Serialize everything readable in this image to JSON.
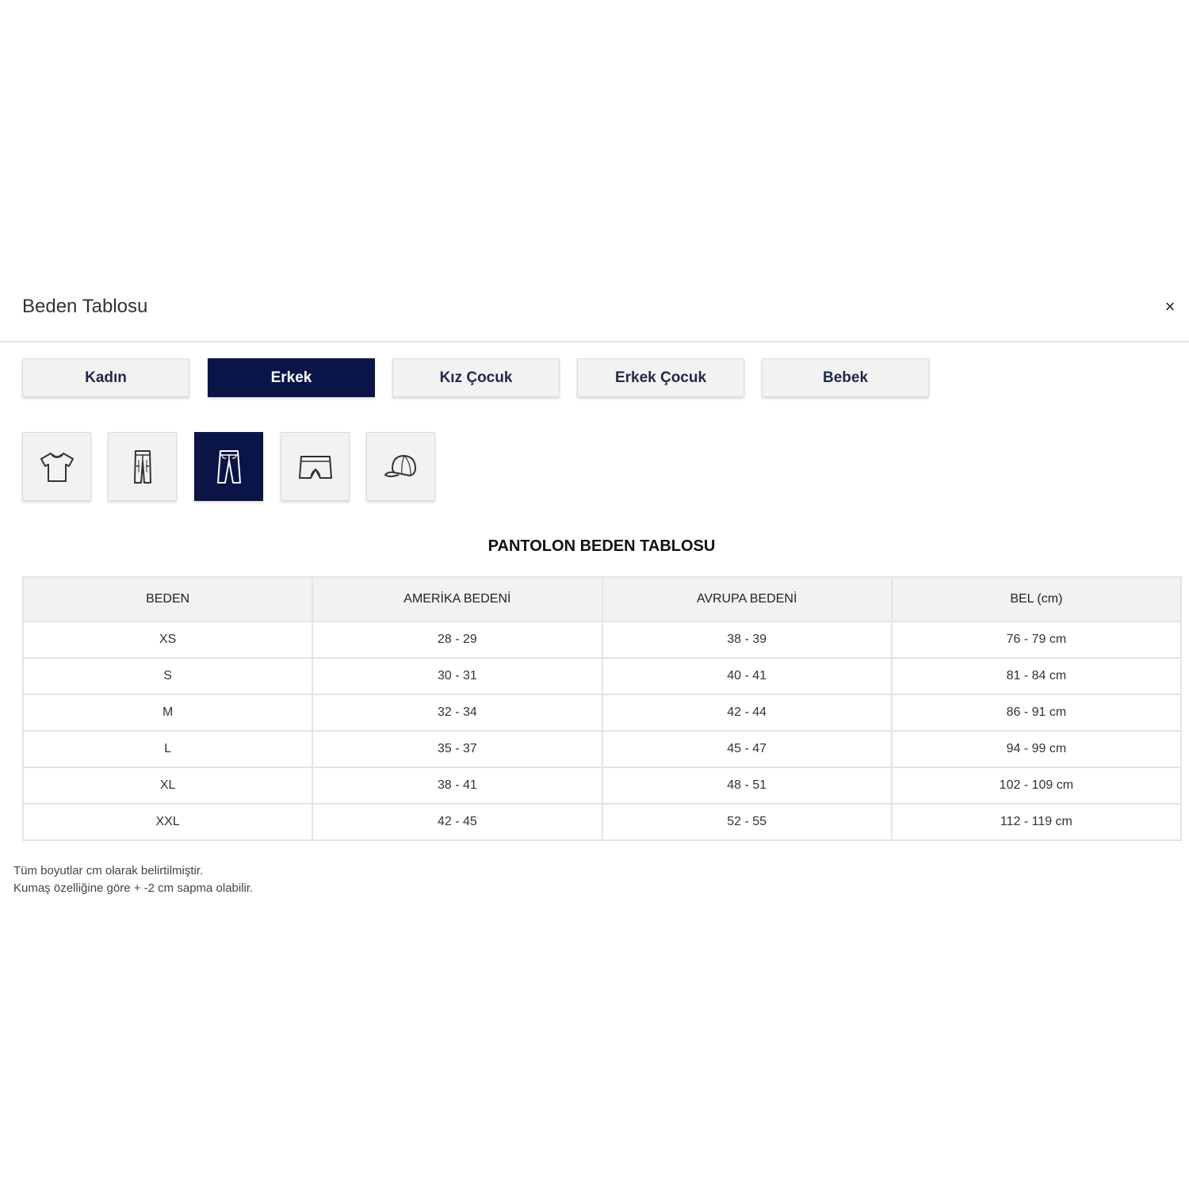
{
  "modal": {
    "title": "Beden Tablosu",
    "close_icon": "×"
  },
  "tabs": [
    {
      "label": "Kadın",
      "active": false
    },
    {
      "label": "Erkek",
      "active": true
    },
    {
      "label": "Kız Çocuk",
      "active": false
    },
    {
      "label": "Erkek Çocuk",
      "active": false
    },
    {
      "label": "Bebek",
      "active": false
    }
  ],
  "categories": [
    {
      "icon": "tshirt-icon",
      "active": false
    },
    {
      "icon": "jeans-icon",
      "active": false
    },
    {
      "icon": "pants-icon",
      "active": true
    },
    {
      "icon": "shorts-icon",
      "active": false
    },
    {
      "icon": "cap-icon",
      "active": false
    }
  ],
  "table": {
    "title": "PANTOLON BEDEN TABLOSU",
    "headers": [
      "BEDEN",
      "AMERİKA BEDENİ",
      "AVRUPA BEDENİ",
      "BEL (cm)"
    ],
    "rows": [
      [
        "XS",
        "28 - 29",
        "38 - 39",
        "76 - 79 cm"
      ],
      [
        "S",
        "30 - 31",
        "40 - 41",
        "81 - 84 cm"
      ],
      [
        "M",
        "32 - 34",
        "42 - 44",
        "86 - 91 cm"
      ],
      [
        "L",
        "35 - 37",
        "45 - 47",
        "94 - 99 cm"
      ],
      [
        "XL",
        "38 - 41",
        "48 - 51",
        "102 - 109 cm"
      ],
      [
        "XXL",
        "42 - 45",
        "52 - 55",
        "112 - 119 cm"
      ]
    ]
  },
  "notes": {
    "line1": "Tüm boyutlar cm olarak belirtilmiştir.",
    "line2": "Kumaş özelliğine göre + -2 cm sapma olabilir."
  },
  "colors": {
    "active": "#0a1446",
    "tab_bg": "#f2f2f2",
    "border": "#e4e4e4"
  }
}
